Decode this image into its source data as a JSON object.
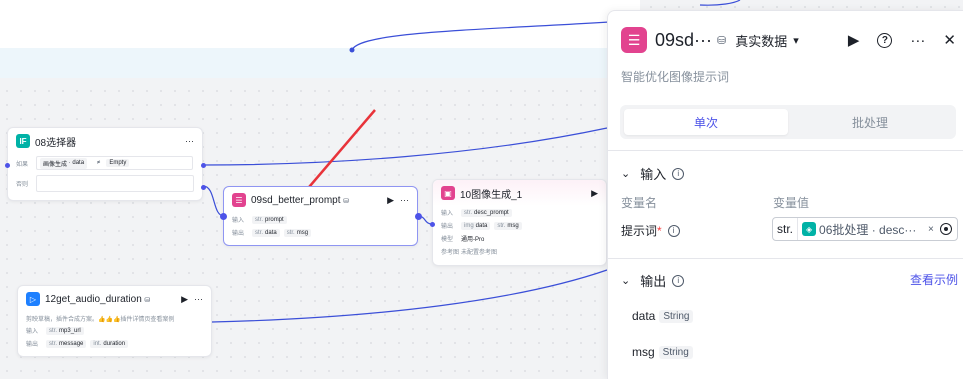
{
  "selector_node": {
    "icon": "IF",
    "icon_color": "#00b2a6",
    "title": "08选择器",
    "more": "···",
    "row1_label": "如果",
    "row1_ref_a": "画像生成",
    "row1_ref_b": "data",
    "row1_op": "≠",
    "row1_value": "Empty",
    "row2_label": "否则"
  },
  "prompt_node": {
    "icon_color": "#e2438f",
    "title": "09sd_better_prompt",
    "db_icon": "database-icon",
    "run": "▶",
    "more": "···",
    "input_label": "输入",
    "input_tag_type": "str.",
    "input_tag": "prompt",
    "output_label": "输出",
    "output_tags": [
      {
        "type": "str.",
        "name": "data"
      },
      {
        "type": "str.",
        "name": "msg"
      }
    ]
  },
  "image_node": {
    "icon_color": "#e2438f",
    "title": "10图像生成_1",
    "run": "▶",
    "input_label": "输入",
    "input_tag_type": "str.",
    "input_tag": "desc_prompt",
    "output_label": "输出",
    "output_tags": [
      {
        "type": "img",
        "name": "data"
      },
      {
        "type": "str.",
        "name": "msg"
      }
    ],
    "model_label": "模型",
    "model_value": "通用-Pro",
    "ref_label": "参考图",
    "ref_value": "未配置参考图"
  },
  "audio_node": {
    "icon_color": "#1e80ff",
    "title": "12get_audio_duration",
    "db_icon": "database-icon",
    "run": "▶",
    "more": "···",
    "desc": "剪映草稿，插件合成方案。👍👍👍插件详情页查看案例",
    "input_label": "输入",
    "input_tag_type": "str.",
    "input_tag": "mp3_url",
    "output_label": "输出",
    "output_tags": [
      {
        "type": "str.",
        "name": "message"
      },
      {
        "type": "int.",
        "name": "duration"
      }
    ]
  },
  "panel": {
    "title": "09sd···",
    "data_source": "真实数据",
    "data_source_caret": "▾",
    "icons": [
      "play-icon",
      "help-icon",
      "more-icon",
      "close-icon"
    ],
    "run": "▶",
    "help": "?",
    "more": "···",
    "close": "✕",
    "description": "智能优化图像提示词",
    "tabs": [
      {
        "label": "单次",
        "active": true
      },
      {
        "label": "批处理",
        "active": false
      }
    ],
    "input_section": "输入",
    "col_name": "变量名",
    "col_value": "变量值",
    "field_label": "提示词",
    "field_required": "*",
    "field_type": "str.",
    "field_ref": "06批处理 · desc···",
    "field_clear": "×",
    "output_section": "输出",
    "example_link": "查看示例",
    "outputs": [
      {
        "name": "data",
        "type": "String"
      },
      {
        "name": "msg",
        "type": "String"
      }
    ]
  },
  "colors": {
    "accent": "#4d53e8",
    "wire": "#3b4fd8",
    "arrow": "#e8333a"
  }
}
